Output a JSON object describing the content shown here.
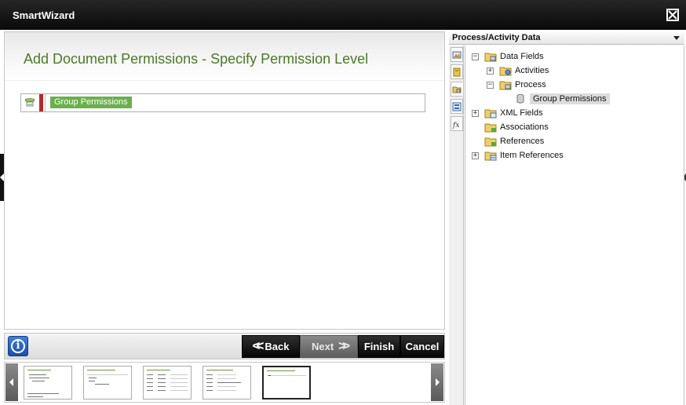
{
  "window": {
    "title": "SmartWizard"
  },
  "wizard": {
    "page_title": "Add Document Permissions - Specify Permission Level",
    "permission_chip": "Group Permissions"
  },
  "nav": {
    "back_label": "Back",
    "next_label": "Next",
    "finish_label": "Finish",
    "cancel_label": "Cancel",
    "back_glyph": "<<",
    "next_glyph": ">>"
  },
  "panel": {
    "title": "Process/Activity Data",
    "tree": [
      {
        "label": "Data Fields",
        "state": "expanded",
        "icon": "folder-icon"
      },
      {
        "label": "Activities",
        "state": "collapsed",
        "icon": "folder-activity-icon"
      },
      {
        "label": "Process",
        "state": "expanded",
        "icon": "folder-process-icon"
      },
      {
        "label": "Group Permissions",
        "state": "leaf",
        "icon": "field-cylinder-icon",
        "selected": true
      },
      {
        "label": "XML Fields",
        "state": "collapsed",
        "icon": "folder-xml-icon"
      },
      {
        "label": "Associations",
        "state": "none",
        "icon": "folder-association-icon"
      },
      {
        "label": "References",
        "state": "none",
        "icon": "folder-reference-icon"
      },
      {
        "label": "Item References",
        "state": "collapsed",
        "icon": "folder-item-reference-icon"
      }
    ],
    "expand_glyph": "+",
    "collapse_glyph": "−"
  },
  "info": {
    "glyph": "i"
  },
  "colors": {
    "accent_green": "#4a7a26",
    "chip_green": "#6ab04c",
    "required_red": "#b32a2a",
    "toolbar_black": "#050505"
  }
}
